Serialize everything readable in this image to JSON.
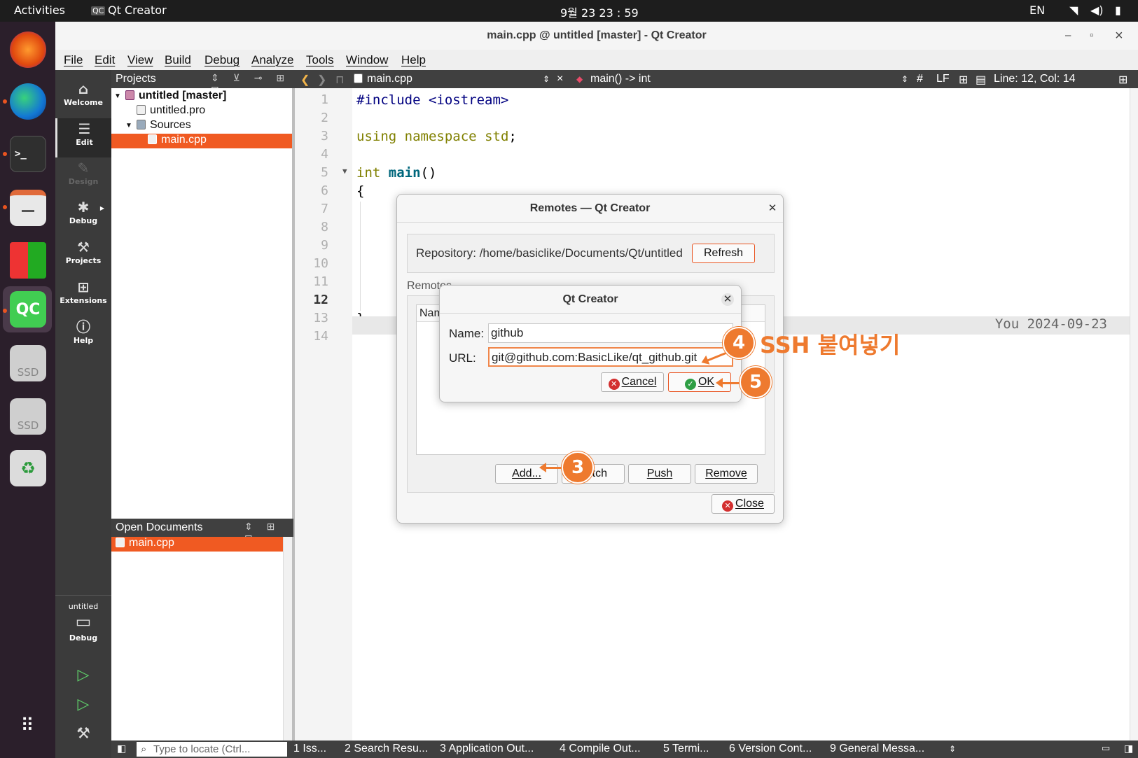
{
  "topbar": {
    "activities": "Activities",
    "app_name": "Qt Creator",
    "clock": "9월 23  23 : 59",
    "lang": "EN"
  },
  "window": {
    "title": "main.cpp @ untitled [master] - Qt Creator",
    "minimize": "–",
    "maximize": "▫",
    "close": "×"
  },
  "menu": {
    "file": "File",
    "edit": "Edit",
    "view": "View",
    "build": "Build",
    "debug": "Debug",
    "analyze": "Analyze",
    "tools": "Tools",
    "window": "Window",
    "help": "Help"
  },
  "modes": {
    "welcome": "Welcome",
    "edit": "Edit",
    "design": "Design",
    "debug": "Debug",
    "projects": "Projects",
    "extensions": "Extensions",
    "help": "Help",
    "kit_project": "untitled",
    "kit_config": "Debug"
  },
  "projects_pane": {
    "title": "Projects",
    "root": "untitled [master]",
    "pro_file": "untitled.pro",
    "sources": "Sources",
    "main_file": "main.cpp"
  },
  "open_docs": {
    "title": "Open Documents",
    "item": "main.cpp"
  },
  "editor": {
    "file": "main.cpp",
    "symbol": "main() -> int",
    "hash": "#",
    "line_ending": "LF",
    "position": "Line: 12, Col: 14",
    "line_numbers": [
      "1",
      "2",
      "3",
      "4",
      "5",
      "6",
      "7",
      "8",
      "9",
      "10",
      "11",
      "12",
      "13",
      "14"
    ],
    "code": {
      "l1_pp": "#include <iostream>",
      "l3_kw1": "using",
      "l3_kw2": "namespace",
      "l3_kw3": "std",
      "l3_end": ";",
      "l5_kw": "int",
      "l5_fn": "main",
      "l5_end": "()",
      "l6": "{",
      "l13": "}"
    },
    "blame": "You 2024-09-23"
  },
  "bottombar": {
    "locate_placeholder": "Type to locate (Ctrl...",
    "tabs": [
      "1  Iss...",
      "2  Search Resu...",
      "3  Application Out...",
      "4  Compile Out...",
      "5  Termi...",
      "6  Version Cont...",
      "9  General Messa..."
    ]
  },
  "remotes_dialog": {
    "title": "Remotes — Qt Creator",
    "repository_label": "Repository: /home/basiclike/Documents/Qt/untitled",
    "refresh": "Refresh",
    "remotes_label": "Remotes",
    "name_col": "Name",
    "add": "Add...",
    "fetch": "Fetch",
    "push": "Push",
    "remove": "Remove",
    "close": "Close"
  },
  "add_remote_dialog": {
    "title": "Qt Creator",
    "name_label": "Name:",
    "name_value": "github",
    "url_label": "URL:",
    "url_value": "git@github.com:BasicLike/qt_github.git",
    "cancel": "Cancel",
    "ok": "OK"
  },
  "annotations": {
    "step3": "3",
    "step4": "4",
    "step4_text": "SSH 붙여넣기",
    "step5": "5"
  },
  "colors": {
    "accent": "#f05a22",
    "annotation": "#ee7a2f",
    "dock": "#2b1f2b",
    "sidebar": "#3b3b3b"
  }
}
